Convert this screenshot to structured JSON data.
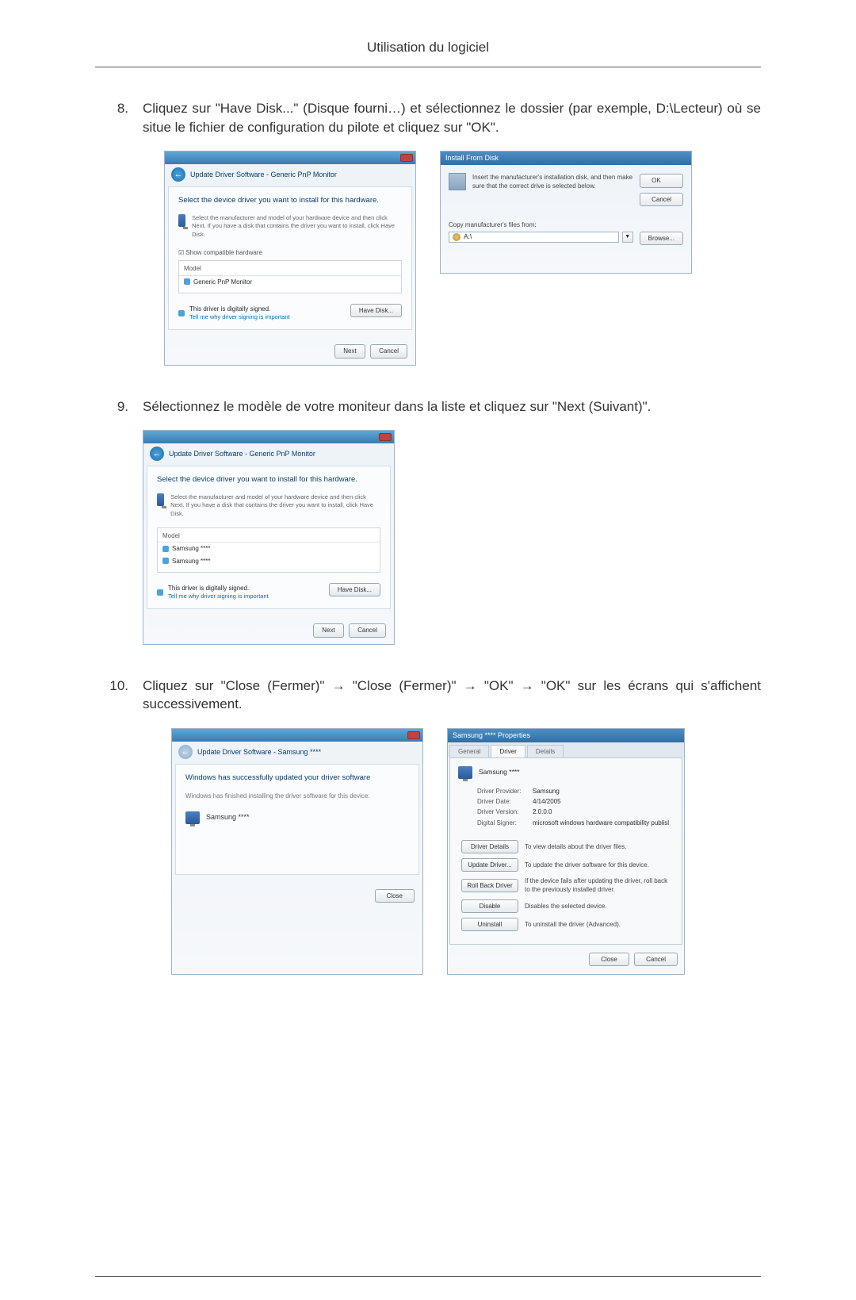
{
  "header": {
    "title": "Utilisation du logiciel"
  },
  "steps": {
    "s8": {
      "num": "8.",
      "text": "Cliquez sur \"Have Disk...\" (Disque fourni…) et sélectionnez le dossier (par exemple, D:\\Lecteur) où se situe le fichier de configuration du pilote et cliquez sur \"OK\"."
    },
    "s9": {
      "num": "9.",
      "text": "Sélectionnez le modèle de votre moniteur dans la liste et cliquez sur \"Next (Suivant)\"."
    },
    "s10": {
      "num": "10.",
      "text": "Cliquez sur \"Close (Fermer)\" → \"Close (Fermer)\" → \"OK\" → \"OK\" sur les écrans qui s'affichent successivement."
    }
  },
  "dlg_update1": {
    "crumb": "Update Driver Software - Generic PnP Monitor",
    "headline": "Select the device driver you want to install for this hardware.",
    "instr": "Select the manufacturer and model of your hardware device and then click Next. If you have a disk that contains the driver you want to install, click Have Disk.",
    "show_compatible": "Show compatible hardware",
    "col": "Model",
    "row1": "Generic PnP Monitor",
    "signed": "This driver is digitally signed.",
    "signed_link": "Tell me why driver signing is important",
    "have_disk": "Have Disk...",
    "next": "Next",
    "cancel": "Cancel"
  },
  "dlg_disk": {
    "title": "Install From Disk",
    "instr": "Insert the manufacturer's installation disk, and then make sure that the correct drive is selected below.",
    "ok": "OK",
    "cancel": "Cancel",
    "copy_label": "Copy manufacturer's files from:",
    "path": "A:\\",
    "browse": "Browse..."
  },
  "dlg_update2": {
    "crumb": "Update Driver Software - Generic PnP Monitor",
    "headline": "Select the device driver you want to install for this hardware.",
    "instr": "Select the manufacturer and model of your hardware device and then click Next. If you have a disk that contains the driver you want to install, click Have Disk.",
    "col": "Model",
    "row1": "Samsung ****",
    "row2": "Samsung ****",
    "signed": "This driver is digitally signed.",
    "signed_link": "Tell me why driver signing is important",
    "have_disk": "Have Disk...",
    "next": "Next",
    "cancel": "Cancel"
  },
  "dlg_success": {
    "crumb": "Update Driver Software - Samsung ****",
    "headline": "Windows has successfully updated your driver software",
    "sub": "Windows has finished installing the driver software for this device:",
    "device": "Samsung ****",
    "close": "Close"
  },
  "dlg_props": {
    "title": "Samsung **** Properties",
    "tab_general": "General",
    "tab_driver": "Driver",
    "tab_details": "Details",
    "device": "Samsung ****",
    "provider_k": "Driver Provider:",
    "provider_v": "Samsung",
    "date_k": "Driver Date:",
    "date_v": "4/14/2005",
    "version_k": "Driver Version:",
    "version_v": "2.0.0.0",
    "signer_k": "Digital Signer:",
    "signer_v": "microsoft windows hardware compatibility publisl",
    "btn_details": "Driver Details",
    "btn_details_d": "To view details about the driver files.",
    "btn_update": "Update Driver...",
    "btn_update_d": "To update the driver software for this device.",
    "btn_rollback": "Roll Back Driver",
    "btn_rollback_d": "If the device fails after updating the driver, roll back to the previously installed driver.",
    "btn_disable": "Disable",
    "btn_disable_d": "Disables the selected device.",
    "btn_uninstall": "Uninstall",
    "btn_uninstall_d": "To uninstall the driver (Advanced).",
    "close": "Close",
    "cancel": "Cancel"
  }
}
